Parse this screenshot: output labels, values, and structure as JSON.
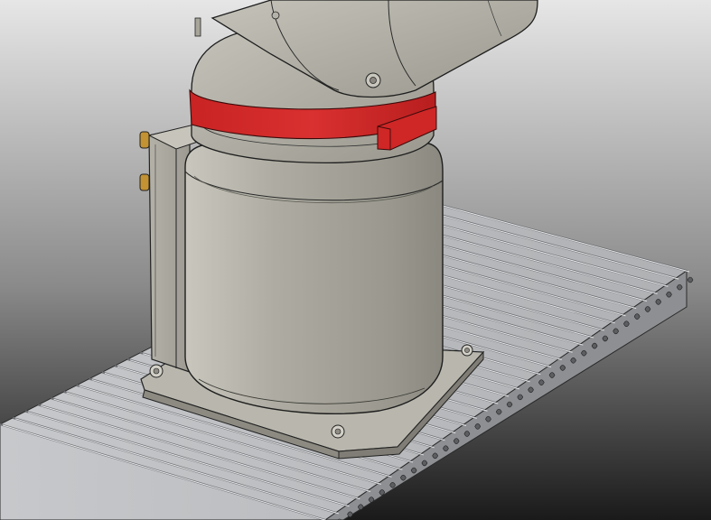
{
  "scene": {
    "subject": "robot-arm-base-on-slotted-extrusion-plate",
    "colors": {
      "bg_top": "#e6e6e6",
      "bg_bottom": "#1a1a1a",
      "body": "#a8a69b",
      "body_light": "#c4c2b8",
      "body_dark": "#7c7a71",
      "accent_red": "#d22a2a",
      "accent_red_dark": "#9c1c1c",
      "rail": "#c9cbce",
      "rail_dark": "#6e7073",
      "brass": "#b98a2c",
      "edge": "#1f1f1f"
    },
    "icons": {
      "mounting-screw": "screw-head-icon",
      "cable-connector": "connector-icon"
    }
  }
}
